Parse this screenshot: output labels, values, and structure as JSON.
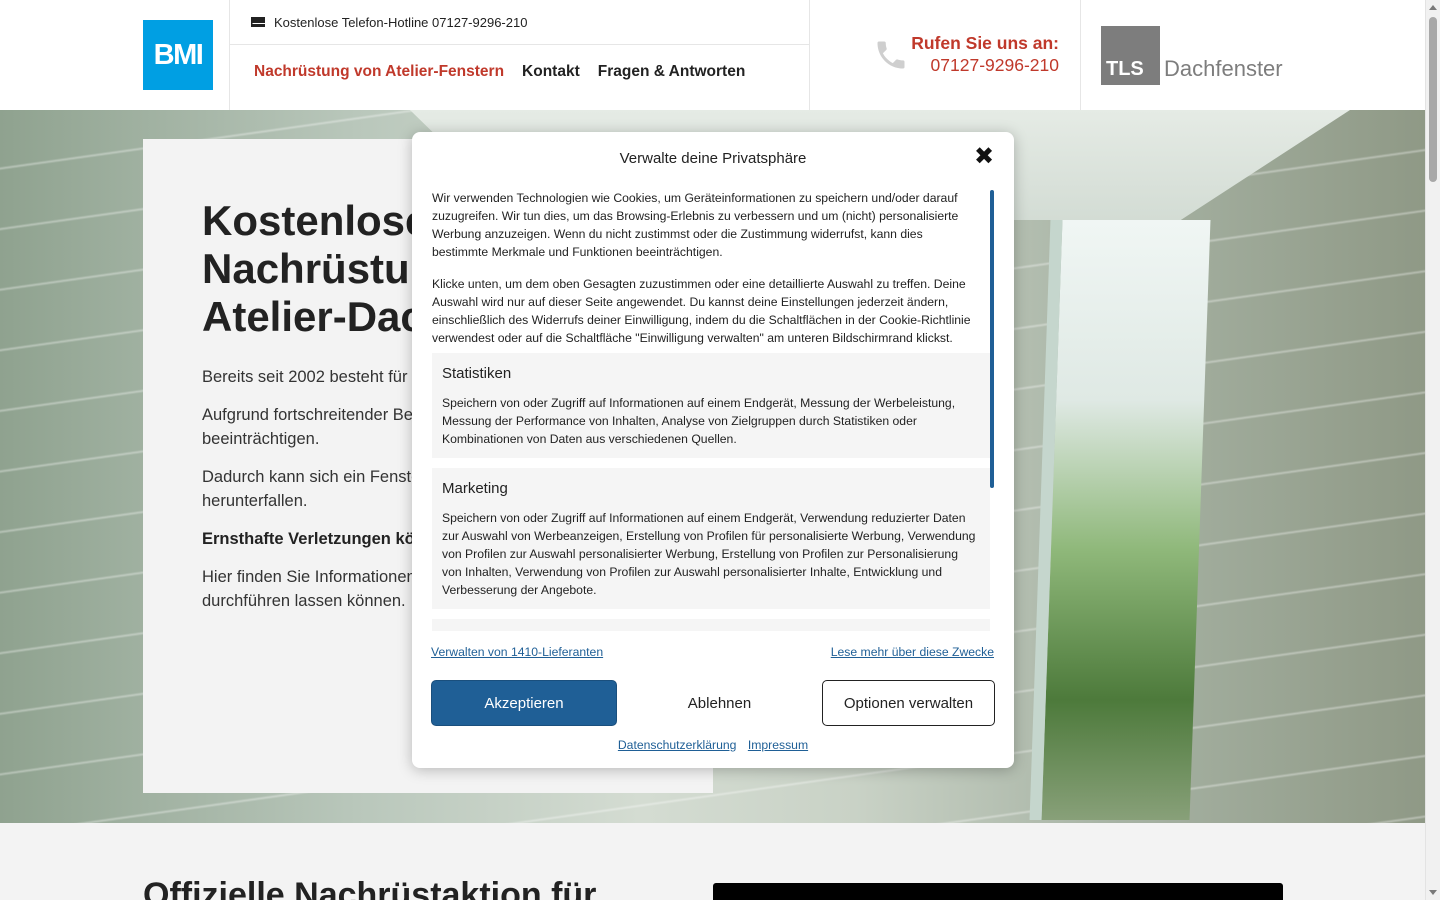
{
  "header": {
    "logo_text": "BMI",
    "hotline": "Kostenlose Telefon-Hotline 07127-9296-210",
    "nav": [
      {
        "label": "Nachrüstung von Atelier-Fenstern",
        "active": true
      },
      {
        "label": "Kontakt",
        "active": false
      },
      {
        "label": "Fragen & Antworten",
        "active": false
      }
    ],
    "call_label": "Rufen Sie uns an:",
    "call_number": "07127-9296-210",
    "tls_box": "TLS",
    "tls_text": "Dachfenster"
  },
  "hero": {
    "title_lines": [
      "Kostenlose",
      "Nachrüstur",
      "Atelier-Dac"
    ],
    "paragraphs": [
      "Bereits seit 2002 besteht für I ein umfangreiches Nachrüstp",
      "Aufgrund fortschreitender Be und die Verbindung zwischen beeinträchtigen.",
      "Dadurch kann sich ein Fenste Dachfläche herunterrutschen herunterfallen.",
      "Ernsthafte Verletzungen könn werden.",
      "Hier finden Sie Informationen werden muss und wie Sie die durchführen lassen können."
    ]
  },
  "section2": {
    "title": "Offizielle Nachrüstaktion für"
  },
  "consent": {
    "title": "Verwalte deine Privatsphäre",
    "intro": [
      "Wir verwenden Technologien wie Cookies, um Geräteinformationen zu speichern und/oder darauf zuzugreifen. Wir tun dies, um das Browsing-Erlebnis zu verbessern und um (nicht) personalisierte Werbung anzuzeigen. Wenn du nicht zustimmst oder die Zustimmung widerrufst, kann dies bestimmte Merkmale und Funktionen beeinträchtigen.",
      "Klicke unten, um dem oben Gesagten zuzustimmen oder eine detaillierte Auswahl zu treffen. Deine Auswahl wird nur auf dieser Seite angewendet. Du kannst deine Einstellungen jederzeit ändern, einschließlich des Widerrufs deiner Einwilligung, indem du die Schaltflächen in der Cookie-Richtlinie verwendest oder auf die Schaltfläche \"Einwilligung verwalten\" am unteren Bildschirmrand klickst."
    ],
    "categories": [
      {
        "title": "Statistiken",
        "description": "Speichern von oder Zugriff auf Informationen auf einem Endgerät, Messung der Werbeleistung, Messung der Performance von Inhalten, Analyse von Zielgruppen durch Statistiken oder Kombinationen von Daten aus verschiedenen Quellen."
      },
      {
        "title": "Marketing",
        "description": "Speichern von oder Zugriff auf Informationen auf einem Endgerät, Verwendung reduzierter Daten zur Auswahl von Werbeanzeigen, Erstellung von Profilen für personalisierte Werbung, Verwendung von Profilen zur Auswahl personalisierter Werbung, Erstellung von Profilen zur Personalisierung von Inhalten, Verwendung von Profilen zur Auswahl personalisierter Inhalte, Entwicklung und Verbesserung der Angebote."
      }
    ],
    "link_vendors": "Verwalten von 1410-Lieferanten",
    "link_purposes": "Lese mehr über diese Zwecke",
    "btn_accept": "Akzeptieren",
    "btn_deny": "Ablehnen",
    "btn_options": "Optionen verwalten",
    "footer_privacy": "Datenschutzerklärung",
    "footer_imprint": "Impressum",
    "close_symbol": "✖"
  },
  "colors": {
    "accent_red": "#c0392b",
    "consent_blue": "#1f5f96",
    "bmi_blue": "#009fe3",
    "tls_gray": "#7d7d7d"
  }
}
